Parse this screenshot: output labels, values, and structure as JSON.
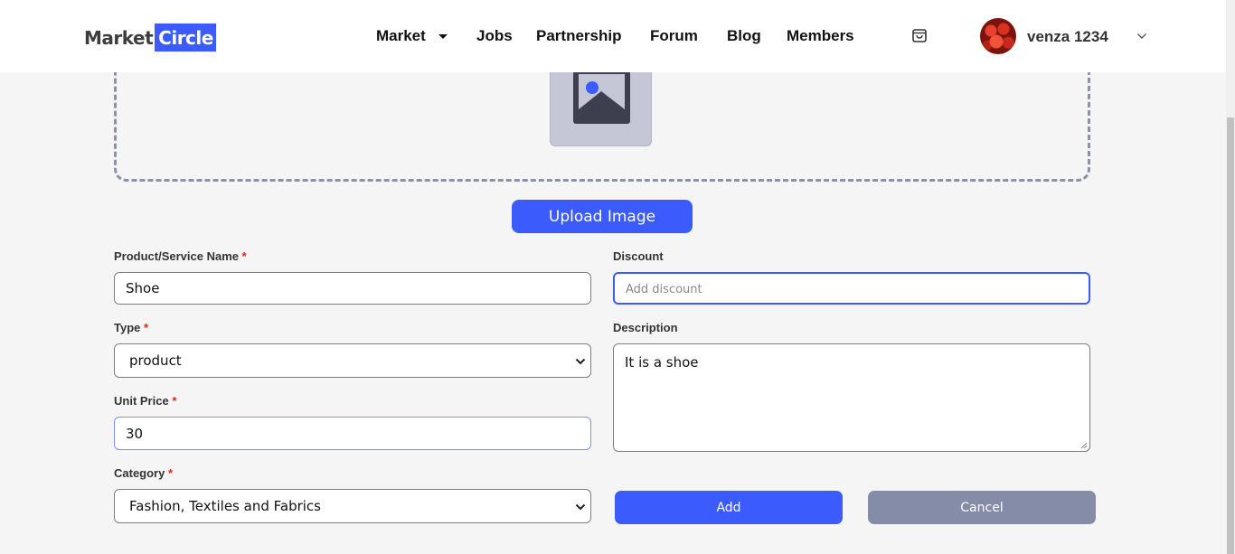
{
  "header": {
    "logo": {
      "part1": "Market",
      "part2": "Circle"
    },
    "nav": [
      {
        "label": "Market"
      },
      {
        "label": "Jobs"
      },
      {
        "label": "Partnership"
      },
      {
        "label": "Forum"
      },
      {
        "label": "Blog"
      },
      {
        "label": "Members"
      }
    ],
    "cart_icon": "shopping-bag-icon",
    "user": {
      "name": "venza 1234"
    }
  },
  "upload": {
    "placeholder_icon": "image-icon",
    "button_label": "Upload Image"
  },
  "form": {
    "required_mark": "*",
    "product_name": {
      "label": "Product/Service Name",
      "value": "Shoe"
    },
    "discount": {
      "label": "Discount",
      "value": "",
      "placeholder": "Add discount"
    },
    "type": {
      "label": "Type",
      "selected": "product"
    },
    "description": {
      "label": "Description",
      "value": "It is a shoe"
    },
    "unit_price": {
      "label": "Unit Price",
      "value": "30"
    },
    "category": {
      "label": "Category",
      "selected": "Fashion, Textiles and Fabrics"
    },
    "add_label": "Add",
    "cancel_label": "Cancel"
  },
  "colors": {
    "accent": "#3b5bfd",
    "cancel": "#858ca8",
    "required": "#e02424",
    "background": "#f5f5f5"
  }
}
